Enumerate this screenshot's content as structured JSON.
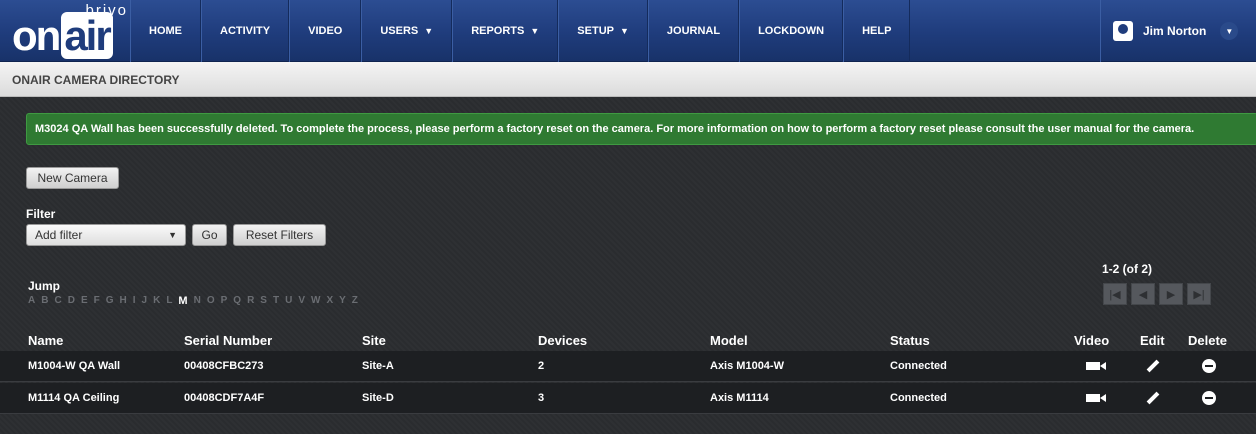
{
  "logo": {
    "top": "brivo",
    "onair": "on",
    "air": "air"
  },
  "nav": [
    {
      "label": "HOME",
      "caret": false
    },
    {
      "label": "ACTIVITY",
      "caret": false
    },
    {
      "label": "VIDEO",
      "caret": false
    },
    {
      "label": "USERS",
      "caret": true
    },
    {
      "label": "REPORTS",
      "caret": true
    },
    {
      "label": "SETUP",
      "caret": true
    },
    {
      "label": "JOURNAL",
      "caret": false
    },
    {
      "label": "LOCKDOWN",
      "caret": false
    },
    {
      "label": "HELP",
      "caret": false
    }
  ],
  "user": {
    "name": "Jim Norton",
    "icon": "user-badge-icon"
  },
  "page_title": "ONAIR CAMERA DIRECTORY",
  "success_message": "M3024 QA Wall has been successfully deleted. To complete the process, please perform a factory reset on the camera. For more information on how to perform a factory reset please consult the user manual for the camera.",
  "buttons": {
    "new_camera": "New Camera",
    "go": "Go",
    "reset_filters": "Reset Filters"
  },
  "filter": {
    "label": "Filter",
    "selected": "Add filter"
  },
  "jump": {
    "label": "Jump",
    "letters": [
      "A",
      "B",
      "C",
      "D",
      "E",
      "F",
      "G",
      "H",
      "I",
      "J",
      "K",
      "L",
      "M",
      "N",
      "O",
      "P",
      "Q",
      "R",
      "S",
      "T",
      "U",
      "V",
      "W",
      "X",
      "Y",
      "Z"
    ],
    "active": "M"
  },
  "pagination": {
    "text": "1-2 (of 2)"
  },
  "table": {
    "headers": {
      "name": "Name",
      "serial": "Serial Number",
      "site": "Site",
      "devices": "Devices",
      "model": "Model",
      "status": "Status",
      "video": "Video",
      "edit": "Edit",
      "delete": "Delete"
    },
    "rows": [
      {
        "name": "M1004-W QA Wall",
        "serial": "00408CFBC273",
        "site": "Site-A",
        "devices": "2",
        "model": "Axis M1004-W",
        "status": "Connected"
      },
      {
        "name": "M1114 QA Ceiling",
        "serial": "00408CDF7A4F",
        "site": "Site-D",
        "devices": "3",
        "model": "Axis M1114",
        "status": "Connected"
      }
    ]
  },
  "colors": {
    "nav_bg": "#1f3c7c",
    "success_bg": "#2f7a32",
    "row_bg": "#1d1f22"
  }
}
